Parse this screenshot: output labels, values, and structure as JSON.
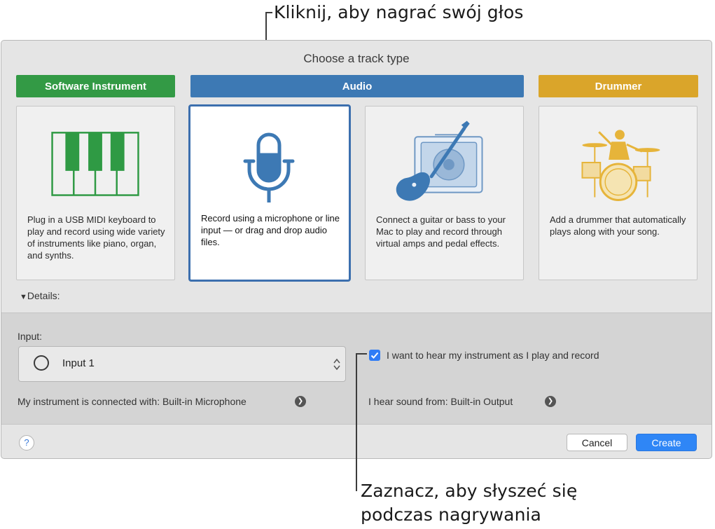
{
  "callouts": {
    "top": "Kliknij, aby nagrać swój głos",
    "bottom_line1": "Zaznacz, aby słyszeć się",
    "bottom_line2": "podczas nagrywania"
  },
  "dialog": {
    "title": "Choose a track type",
    "track_types": [
      {
        "label": "Software Instrument",
        "color": "#339a45",
        "description": "Plug in a USB MIDI keyboard to play and record using wide variety of instruments like piano, organ, and synths.",
        "icon": "piano-keyboard-icon",
        "selected": false
      },
      {
        "label": "Audio",
        "color": "#3d79b4",
        "description": "Record using a microphone or line input — or drag and drop audio files.",
        "icon": "microphone-icon",
        "selected": true
      },
      {
        "label": "",
        "color": "#3d79b4",
        "description": "Connect a guitar or bass to your Mac to play and record through virtual amps and pedal effects.",
        "icon": "guitar-amp-icon",
        "selected": false
      },
      {
        "label": "Drummer",
        "color": "#daa52a",
        "description": "Add a drummer that automatically plays along with your song.",
        "icon": "drummer-icon",
        "selected": false
      }
    ],
    "details_label": "Details:",
    "details": {
      "input_label": "Input:",
      "input_value": "Input 1",
      "connected_with": "My instrument is connected with: Built-in Microphone",
      "monitor_checkbox_label": "I want to hear my instrument as I play and record",
      "monitor_checked": true,
      "output_text": "I hear sound from: Built-in Output"
    },
    "buttons": {
      "help": "?",
      "cancel": "Cancel",
      "create": "Create"
    }
  }
}
